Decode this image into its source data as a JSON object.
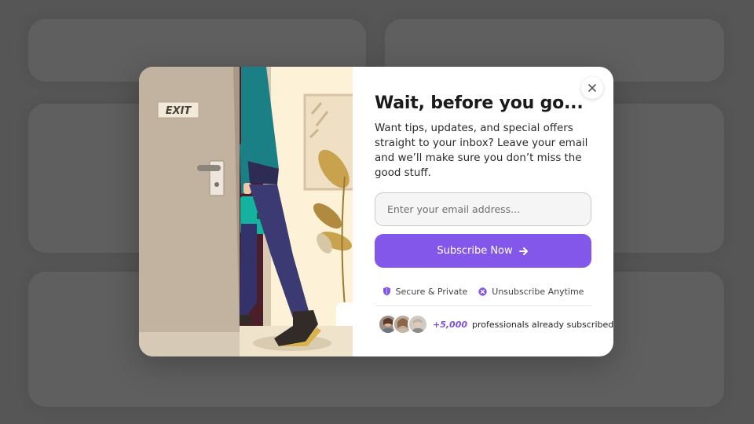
{
  "modal": {
    "exit_sign": "EXIT",
    "title": "Wait, before you go...",
    "description": "Want tips, updates, and special offers straight to your inbox? Leave your email and we’ll make sure you don’t miss the good stuff.",
    "email_placeholder": "Enter your email address...",
    "email_value": "",
    "subscribe_label": "Subscribe Now",
    "assurances": [
      {
        "label": "Secure & Private",
        "icon": "shield-icon"
      },
      {
        "label": "Unsubscribe Anytime",
        "icon": "x-circle-icon"
      }
    ],
    "social_proof": {
      "count": "+5,000",
      "text": "professionals already subscribed"
    }
  },
  "colors": {
    "accent": "#8257ea",
    "overlay": "#5a5a5a",
    "count_text": "#7c4fe0"
  }
}
